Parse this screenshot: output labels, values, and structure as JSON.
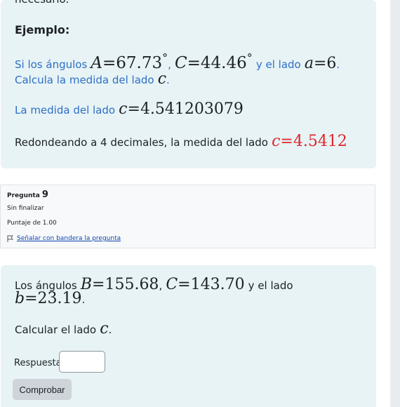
{
  "example": {
    "partial_top": "necesario.",
    "heading": "Ejemplo:",
    "line1": {
      "pre": "Si los ángulos",
      "A_var": "A",
      "A_val": "67.73",
      "C_var": "C",
      "C_val": "44.46",
      "degree": "°",
      "mid": "y el lado",
      "a_var": "a",
      "a_val": "6"
    },
    "line2": {
      "text": "Calcula la medida del lado",
      "var": "c"
    },
    "line3": {
      "text": "La medida del lado",
      "var": "c",
      "val": "4.541203079"
    },
    "line4": {
      "text": "Redondeando a 4 decimales, la medida del lado",
      "var": "c",
      "val": "4.5412"
    }
  },
  "question_info": {
    "label": "Pregunta",
    "number": "9",
    "state": "Sin finalizar",
    "mark": "Puntaje de 1.00",
    "flag_link": "Señalar con bandera la pregunta"
  },
  "question": {
    "line1": {
      "pre": "Los ángulos",
      "B_var": "B",
      "B_val": "155.68",
      "C_var": "C",
      "C_val": "143.70",
      "mid": "y el lado"
    },
    "line2": {
      "b_var": "b",
      "b_val": "23.19"
    },
    "line3": {
      "text": "Calcular el lado",
      "var": "c"
    },
    "answer_label": "Respuesta:",
    "answer_value": "",
    "check_button": "Comprobar"
  }
}
